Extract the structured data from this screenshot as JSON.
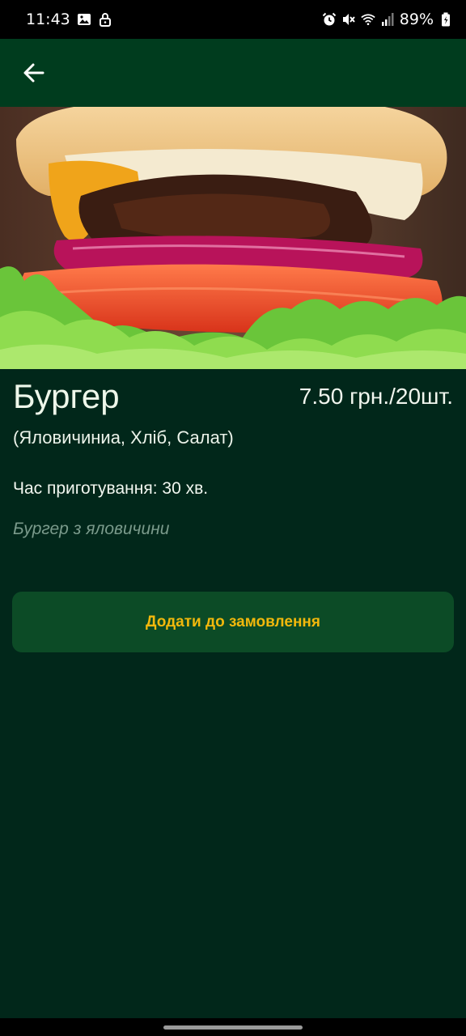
{
  "status_bar": {
    "time": "11:43",
    "battery": "89%",
    "left_icons": [
      "gallery-icon",
      "lock-icon"
    ],
    "right_icons": [
      "alarm-icon",
      "mute-icon",
      "wifi-icon",
      "signal-icon",
      "battery-icon"
    ]
  },
  "app_bar": {
    "back_icon": "arrow-left-icon"
  },
  "hero": {
    "image_subject": "burger photo"
  },
  "dish": {
    "title": "Бургер",
    "price": "7.50 грн./20шт.",
    "ingredients": "(Яловичиниа, Хліб, Салат)",
    "cook_time": "Час приготування: 30 хв.",
    "description": "Бургер з яловичини"
  },
  "actions": {
    "add_to_order": "Додати до замовлення"
  },
  "colors": {
    "background": "#01271a",
    "app_bar": "#003c1e",
    "button_bg": "#0c4b26",
    "button_text": "#f2b80c",
    "muted_text": "#7a9a8b"
  }
}
